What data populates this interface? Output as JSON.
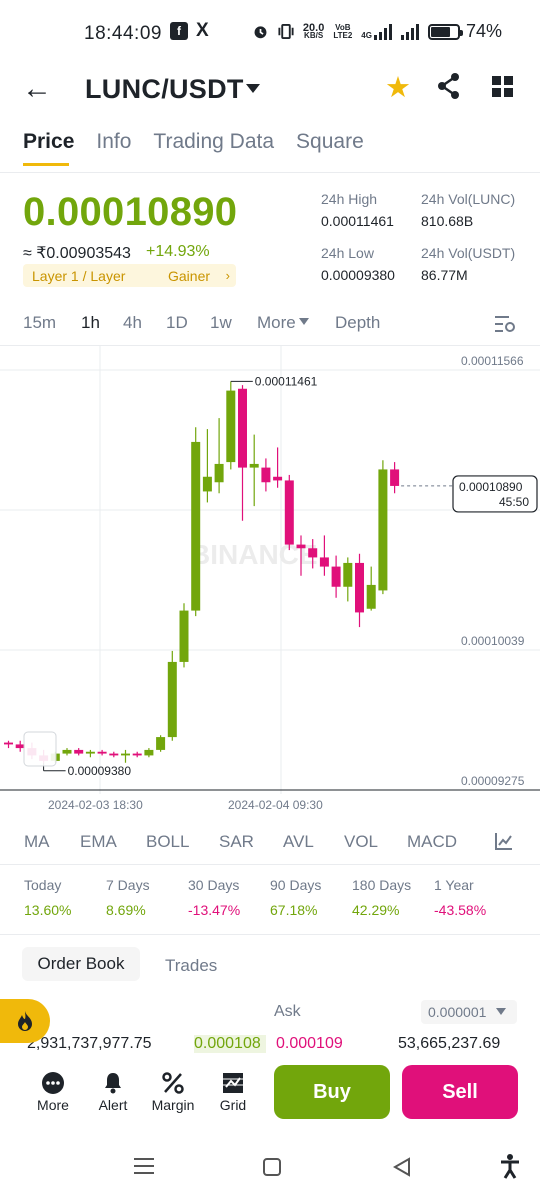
{
  "status_bar": {
    "time": "18:44:09",
    "net_speed_top": "20.0",
    "net_speed_bottom": "KB/S",
    "volte_top": "VoB",
    "volte_bottom": "LTE2",
    "net_type": "4G",
    "battery": "74%",
    "battery_level": 0.74
  },
  "header": {
    "pair": "LUNC/USDT"
  },
  "tabs": [
    "Price",
    "Info",
    "Trading Data",
    "Square"
  ],
  "ticker": {
    "price": "0.00010890",
    "fiat": "≈ ₹0.00903543",
    "change": "+14.93%",
    "tag1": "Layer 1 / Layer",
    "tag2": "Gainer",
    "high_label": "24h High",
    "high_value": "0.00011461",
    "low_label": "24h Low",
    "low_value": "0.00009380",
    "vol_lunc_label": "24h Vol(LUNC)",
    "vol_lunc_value": "810.68B",
    "vol_usdt_label": "24h Vol(USDT)",
    "vol_usdt_value": "86.77M"
  },
  "timeframes": [
    "15m",
    "1h",
    "4h",
    "1D",
    "1w",
    "More",
    "Depth"
  ],
  "chart_data": {
    "type": "candlestick",
    "interval": "1h",
    "watermark": "BINANCE",
    "y_ticks": [
      "0.00011566",
      "0.00010039",
      "0.00009275"
    ],
    "ylim": [
      9.275e-05,
      0.00011566
    ],
    "x_ticks": [
      "2024-02-03 18:30",
      "2024-02-04 09:30"
    ],
    "high_marker": "0.00011461",
    "low_marker": "0.00009380",
    "last_price": "0.00010890",
    "countdown": "45:50",
    "candles": [
      {
        "o": 9.49e-05,
        "h": 9.5e-05,
        "l": 9.46e-05,
        "c": 9.48e-05
      },
      {
        "o": 9.48e-05,
        "h": 9.5e-05,
        "l": 9.44e-05,
        "c": 9.46e-05
      },
      {
        "o": 9.46e-05,
        "h": 9.49e-05,
        "l": 9.4e-05,
        "c": 9.42e-05
      },
      {
        "o": 9.42e-05,
        "h": 9.45e-05,
        "l": 9.38e-05,
        "c": 9.39e-05
      },
      {
        "o": 9.39e-05,
        "h": 9.44e-05,
        "l": 9.38e-05,
        "c": 9.43e-05
      },
      {
        "o": 9.43e-05,
        "h": 9.46e-05,
        "l": 9.42e-05,
        "c": 9.45e-05
      },
      {
        "o": 9.45e-05,
        "h": 9.46e-05,
        "l": 9.42e-05,
        "c": 9.43e-05
      },
      {
        "o": 9.43e-05,
        "h": 9.45e-05,
        "l": 9.41e-05,
        "c": 9.44e-05
      },
      {
        "o": 9.44e-05,
        "h": 9.45e-05,
        "l": 9.42e-05,
        "c": 9.43e-05
      },
      {
        "o": 9.43e-05,
        "h": 9.44e-05,
        "l": 9.41e-05,
        "c": 9.42e-05
      },
      {
        "o": 9.42e-05,
        "h": 9.45e-05,
        "l": 9.38e-05,
        "c": 9.43e-05
      },
      {
        "o": 9.43e-05,
        "h": 9.44e-05,
        "l": 9.41e-05,
        "c": 9.42e-05
      },
      {
        "o": 9.42e-05,
        "h": 9.46e-05,
        "l": 9.41e-05,
        "c": 9.45e-05
      },
      {
        "o": 9.45e-05,
        "h": 9.53e-05,
        "l": 9.44e-05,
        "c": 9.52e-05
      },
      {
        "o": 9.52e-05,
        "h": 9.99e-05,
        "l": 9.5e-05,
        "c": 9.93e-05
      },
      {
        "o": 9.93e-05,
        "h": 0.0001025,
        "l": 9.9e-05,
        "c": 0.0001021
      },
      {
        "o": 0.0001021,
        "h": 0.0001121,
        "l": 0.0001018,
        "c": 0.0001113
      },
      {
        "o": 0.0001086,
        "h": 0.000112,
        "l": 0.000108,
        "c": 0.0001094
      },
      {
        "o": 0.0001091,
        "h": 0.0001126,
        "l": 0.0001085,
        "c": 0.0001101
      },
      {
        "o": 0.0001102,
        "h": 0.0001146,
        "l": 0.0001098,
        "c": 0.0001141
      },
      {
        "o": 0.0001142,
        "h": 0.0001144,
        "l": 0.000107,
        "c": 0.0001099
      },
      {
        "o": 0.0001099,
        "h": 0.0001117,
        "l": 0.0001078,
        "c": 0.0001101
      },
      {
        "o": 0.0001099,
        "h": 0.0001104,
        "l": 0.0001086,
        "c": 0.0001091
      },
      {
        "o": 0.0001094,
        "h": 0.000111,
        "l": 0.0001088,
        "c": 0.0001092
      },
      {
        "o": 0.0001092,
        "h": 0.0001095,
        "l": 0.0001054,
        "c": 0.0001057
      },
      {
        "o": 0.0001057,
        "h": 0.0001062,
        "l": 0.000104,
        "c": 0.0001055
      },
      {
        "o": 0.0001055,
        "h": 0.000106,
        "l": 0.0001044,
        "c": 0.000105
      },
      {
        "o": 0.000105,
        "h": 0.0001062,
        "l": 0.000104,
        "c": 0.0001045
      },
      {
        "o": 0.0001045,
        "h": 0.0001051,
        "l": 0.0001028,
        "c": 0.0001034
      },
      {
        "o": 0.0001034,
        "h": 0.000105,
        "l": 0.0001026,
        "c": 0.0001047
      },
      {
        "o": 0.0001047,
        "h": 0.0001052,
        "l": 0.0001012,
        "c": 0.000102
      },
      {
        "o": 0.0001022,
        "h": 0.0001045,
        "l": 0.0001021,
        "c": 0.0001035
      },
      {
        "o": 0.0001032,
        "h": 0.0001103,
        "l": 0.000103,
        "c": 0.0001098
      },
      {
        "o": 0.0001098,
        "h": 0.0001102,
        "l": 0.0001085,
        "c": 0.0001089
      }
    ]
  },
  "indicators": [
    "MA",
    "EMA",
    "BOLL",
    "SAR",
    "AVL",
    "VOL",
    "MACD"
  ],
  "performance": [
    {
      "label": "Today",
      "value": "13.60%",
      "sign": "pos"
    },
    {
      "label": "7 Days",
      "value": "8.69%",
      "sign": "pos"
    },
    {
      "label": "30 Days",
      "value": "-13.47%",
      "sign": "neg"
    },
    {
      "label": "90 Days",
      "value": "67.18%",
      "sign": "pos"
    },
    {
      "label": "180 Days",
      "value": "42.29%",
      "sign": "pos"
    },
    {
      "label": "1 Year",
      "value": "-43.58%",
      "sign": "neg"
    }
  ],
  "orderbook": {
    "tab_active": "Order Book",
    "tab_other": "Trades",
    "ask_label": "Ask",
    "precision": "0.000001",
    "bid_qty": "2,931,737,977.75",
    "bid_price": "0.000108",
    "ask_price": "0.000109",
    "ask_qty": "53,665,237.69"
  },
  "bottom_bar": {
    "more": "More",
    "alert": "Alert",
    "margin": "Margin",
    "grid": "Grid",
    "buy": "Buy",
    "sell": "Sell"
  },
  "colors": {
    "up": "#72a60c",
    "down": "#e0107a",
    "accent": "#f0b90b"
  }
}
